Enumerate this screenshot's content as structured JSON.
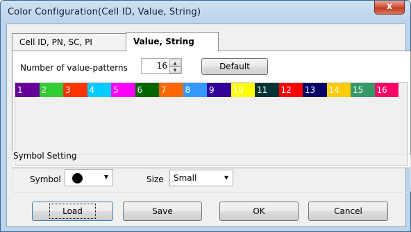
{
  "window": {
    "title": "Color Configuration(Cell ID, Value, String)",
    "close_label": "x"
  },
  "tabs": [
    {
      "label": "Cell ID, PN, SC, PI",
      "active": false
    },
    {
      "label": "Value, String",
      "active": true
    }
  ],
  "value_patterns": {
    "label": "Number of value-patterns",
    "value": "16",
    "up_glyph": "▲",
    "down_glyph": "▼",
    "default_label": "Default"
  },
  "swatches": [
    {
      "label": "1",
      "color": "#660099"
    },
    {
      "label": "2",
      "color": "#33cc33"
    },
    {
      "label": "3",
      "color": "#ff3300"
    },
    {
      "label": "4",
      "color": "#00ccff"
    },
    {
      "label": "5",
      "color": "#ff00ff"
    },
    {
      "label": "6",
      "color": "#006600"
    },
    {
      "label": "7",
      "color": "#ff6600"
    },
    {
      "label": "8",
      "color": "#3399ff"
    },
    {
      "label": "9",
      "color": "#330099"
    },
    {
      "label": "10",
      "color": "#ffff00"
    },
    {
      "label": "11",
      "color": "#003333"
    },
    {
      "label": "12",
      "color": "#ff0000"
    },
    {
      "label": "13",
      "color": "#000066"
    },
    {
      "label": "14",
      "color": "#ffcc00"
    },
    {
      "label": "15",
      "color": "#339966"
    },
    {
      "label": "16",
      "color": "#ff0066"
    }
  ],
  "symbol_setting": {
    "title": "Symbol Setting",
    "symbol_label": "Symbol",
    "symbol_icon": "filled-circle",
    "chevron": "⌄",
    "size_label": "Size",
    "size_value": "Small"
  },
  "buttons": {
    "load": "Load",
    "save": "Save",
    "ok": "OK",
    "cancel": "Cancel"
  }
}
